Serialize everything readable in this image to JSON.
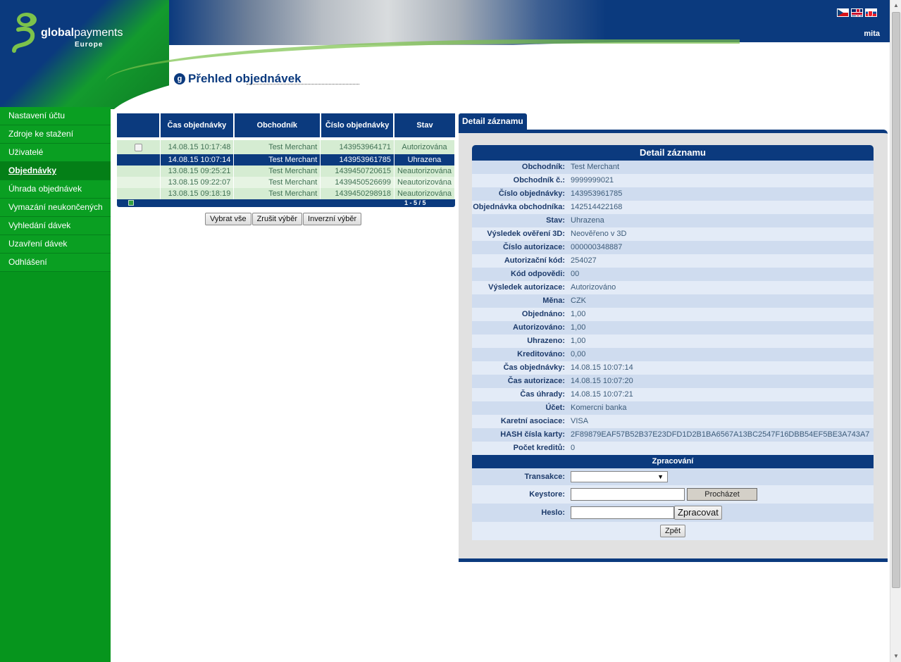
{
  "header": {
    "logo_brand_bold": "global",
    "logo_brand_rest": "payments",
    "logo_sub": "Europe",
    "user": "mita",
    "languages": [
      "cz-flag-icon",
      "en-flag-icon",
      "sk-flag-icon"
    ]
  },
  "page_title": "Přehled objednávek",
  "sidebar": {
    "items": [
      {
        "label": "Nastavení účtu"
      },
      {
        "label": "Zdroje ke stažení"
      },
      {
        "label": "Uživatelé"
      },
      {
        "label": "Objednávky",
        "active": true
      },
      {
        "label": "Úhrada objednávek"
      },
      {
        "label": "Vymazání neukončených"
      },
      {
        "label": "Vyhledání dávek"
      },
      {
        "label": "Uzavření dávek"
      },
      {
        "label": "Odhlášení"
      }
    ]
  },
  "orders": {
    "columns": [
      "",
      "Čas objednávky",
      "Obchodník",
      "Číslo objednávky",
      "Stav"
    ],
    "rows": [
      {
        "time": "14.08.15 10:17:48",
        "merchant": "Test Merchant",
        "number": "143953964171",
        "status": "Autorizována"
      },
      {
        "time": "14.08.15 10:07:14",
        "merchant": "Test Merchant",
        "number": "143953961785",
        "status": "Uhrazena",
        "selected": true
      },
      {
        "time": "13.08.15 09:25:21",
        "merchant": "Test Merchant",
        "number": "1439450720615",
        "status": "Neautorizována"
      },
      {
        "time": "13.08.15 09:22:07",
        "merchant": "Test Merchant",
        "number": "1439450526699",
        "status": "Neautorizována"
      },
      {
        "time": "13.08.15 09:18:19",
        "merchant": "Test Merchant",
        "number": "1439450298918",
        "status": "Neautorizována"
      }
    ],
    "pager": "1 - 5 / 5",
    "buttons": {
      "select_all": "Vybrat vše",
      "clear_selection": "Zrušit výběr",
      "invert_selection": "Inverzní výběr"
    }
  },
  "detail": {
    "tab_label": "Detail záznamu",
    "heading": "Detail záznamu",
    "fields": [
      {
        "label": "Obchodník:",
        "value": "Test Merchant"
      },
      {
        "label": "Obchodník č.:",
        "value": "9999999021"
      },
      {
        "label": "Číslo objednávky:",
        "value": "143953961785"
      },
      {
        "label": "Objednávka obchodníka:",
        "value": "142514422168"
      },
      {
        "label": "Stav:",
        "value": "Uhrazena"
      },
      {
        "label": "Výsledek ověření 3D:",
        "value": "Neověřeno v 3D"
      },
      {
        "label": "Číslo autorizace:",
        "value": "000000348887"
      },
      {
        "label": "Autorizační kód:",
        "value": "254027"
      },
      {
        "label": "Kód odpovědi:",
        "value": "00"
      },
      {
        "label": "Výsledek autorizace:",
        "value": "Autorizováno"
      },
      {
        "label": "Měna:",
        "value": "CZK"
      },
      {
        "label": "Objednáno:",
        "value": "1,00"
      },
      {
        "label": "Autorizováno:",
        "value": "1,00"
      },
      {
        "label": "Uhrazeno:",
        "value": "1,00"
      },
      {
        "label": "Kreditováno:",
        "value": "0,00"
      },
      {
        "label": "Čas objednávky:",
        "value": "14.08.15 10:07:14"
      },
      {
        "label": "Čas autorizace:",
        "value": "14.08.15 10:07:20"
      },
      {
        "label": "Čas úhrady:",
        "value": "14.08.15 10:07:21"
      },
      {
        "label": "Účet:",
        "value": "Komercni banka"
      },
      {
        "label": "Karetní asociace:",
        "value": "VISA"
      },
      {
        "label": "HASH čísla karty:",
        "value": "2F89879EAF57B52B37E23DFD1D2B1BA6567A13BC2547F16DBB54EF5BE3A743A7"
      },
      {
        "label": "Počet kreditů:",
        "value": "0"
      }
    ],
    "processing": {
      "heading": "Zpracování",
      "transaction_label": "Transakce:",
      "transaction_value": "",
      "keystore_label": "Keystore:",
      "browse_button": "Procházet",
      "password_label": "Heslo:",
      "process_button": "Zpracovat",
      "back_button": "Zpět"
    }
  },
  "colors": {
    "brand_blue": "#0b3a7e",
    "brand_green": "#06951d",
    "row_green": "#d5ecd2",
    "row_blue": "#cfdcef"
  }
}
